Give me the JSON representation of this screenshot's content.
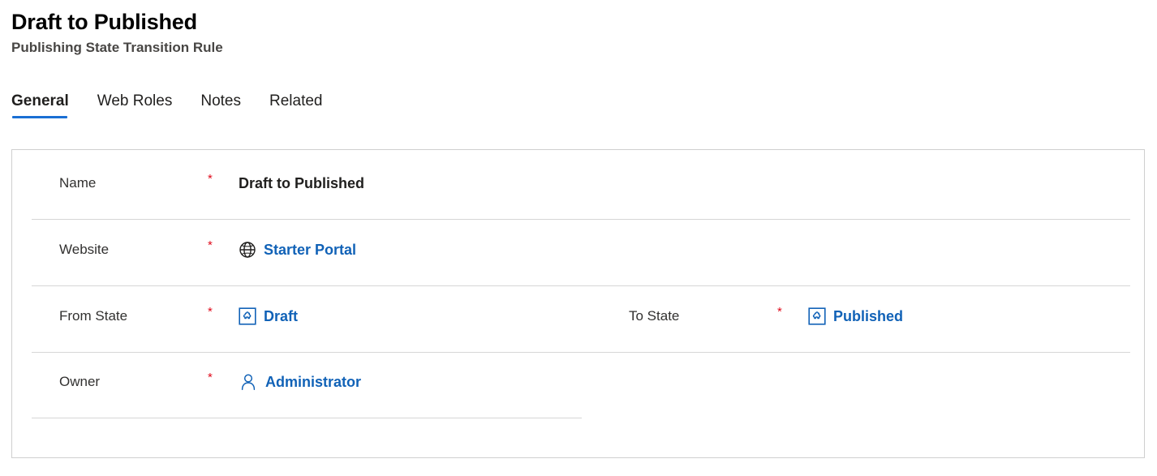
{
  "header": {
    "title": "Draft to Published",
    "subtitle": "Publishing State Transition Rule"
  },
  "tabs": [
    {
      "label": "General",
      "selected": true
    },
    {
      "label": "Web Roles",
      "selected": false
    },
    {
      "label": "Notes",
      "selected": false
    },
    {
      "label": "Related",
      "selected": false
    }
  ],
  "form": {
    "required_marker": "*",
    "fields": {
      "name": {
        "label": "Name",
        "value": "Draft to Published",
        "required": true,
        "icon": null
      },
      "website": {
        "label": "Website",
        "value": "Starter Portal",
        "required": true,
        "icon": "globe-icon"
      },
      "from_state": {
        "label": "From State",
        "value": "Draft",
        "required": true,
        "icon": "entity-record-icon"
      },
      "to_state": {
        "label": "To State",
        "value": "Published",
        "required": true,
        "icon": "entity-record-icon"
      },
      "owner": {
        "label": "Owner",
        "value": "Administrator",
        "required": true,
        "icon": "person-icon"
      }
    }
  },
  "colors": {
    "accent": "#1a6fd4",
    "link": "#1162b7",
    "required": "#e00b1c",
    "border": "#cfcfcf",
    "separator": "#d6d6d6",
    "title": "#000000",
    "subtitle": "#484644"
  }
}
